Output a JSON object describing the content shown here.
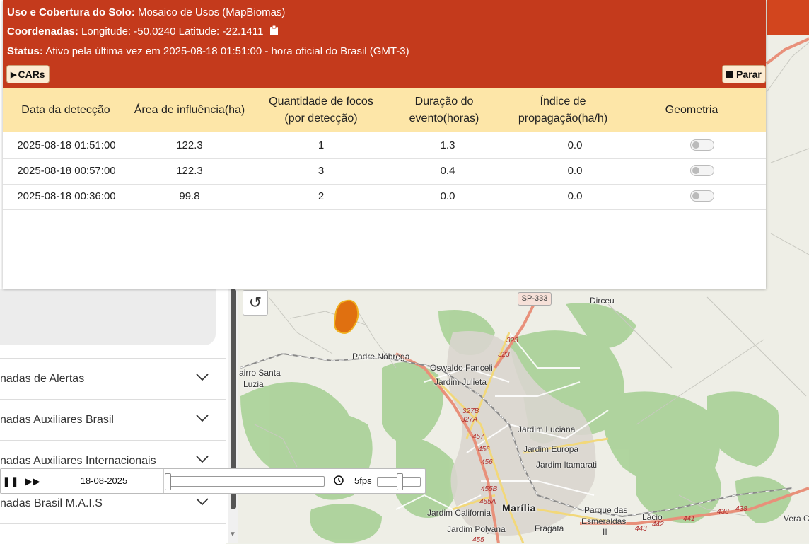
{
  "popup": {
    "land_use_label": "Uso e Cobertura do Solo:",
    "land_use_value": "Mosaico de Usos (MapBiomas)",
    "coords_label": "Coordenadas:",
    "coords_value": "Longitude: -50.0240 Latitude: -22.1411",
    "status_label": "Status:",
    "status_value": "Ativo pela última vez em 2025-08-18 01:51:00 - hora oficial do Brasil (GMT-3)",
    "cars_button": "CARs",
    "stop_button": "Parar",
    "columns": {
      "date": "Data da detecção",
      "area": "Área de influência(ha)",
      "foci_1": "Quantidade de focos",
      "foci_2": "(por detecção)",
      "duration_1": "Duração do",
      "duration_2": "evento(horas)",
      "index_1": "Índice de",
      "index_2": "propagação(ha/h)",
      "geometry": "Geometria"
    },
    "rows": [
      {
        "date": "2025-08-18 01:51:00",
        "area": "122.3",
        "foci": "1",
        "duration": "1.3",
        "index": "0.0"
      },
      {
        "date": "2025-08-18 00:57:00",
        "area": "122.3",
        "foci": "3",
        "duration": "0.4",
        "index": "0.0"
      },
      {
        "date": "2025-08-18 00:36:00",
        "area": "99.8",
        "foci": "2",
        "duration": "0.0",
        "index": "0.0"
      }
    ]
  },
  "sidebar": {
    "items": [
      {
        "label": "nadas de Alertas"
      },
      {
        "label": "nadas Auxiliares Brasil"
      },
      {
        "label": "nadas Auxiliares Internacionais"
      },
      {
        "label": "nadas Brasil M.A.I.S"
      }
    ]
  },
  "timeline": {
    "date": "18-08-2025",
    "fps": "5fps"
  },
  "map": {
    "labels": {
      "dirceu": "Dirceu",
      "sp333": "SP-333",
      "padre_nobrega": "Padre Nóbrega",
      "oswaldo_fanceli": "Oswaldo Fanceli",
      "jardim_julieta": "Jardim Julieta",
      "bairro_santa_1": "airro Santa",
      "bairro_santa_2": "Luzia",
      "jardim_luciana": "Jardim Luciana",
      "jardim_europa": "Jardim Europa",
      "jardim_itamarati": "Jardim Itamarati",
      "jardim_california": "Jardim California",
      "jardim_polyana": "Jardim Polyana",
      "marilia": "Marília",
      "fragata": "Fragata",
      "parque_1": "Parque das",
      "parque_2": "Esmeraldas",
      "parque_3": "II",
      "lacio": "Lácio",
      "vera": "Vera C"
    },
    "shields": [
      "323",
      "323",
      "327B",
      "327A",
      "457",
      "456",
      "456",
      "455B",
      "455A",
      "455",
      "438",
      "438",
      "441",
      "442",
      "443"
    ],
    "refresh_icon": "refresh-icon",
    "fire_color": "#e07010"
  }
}
